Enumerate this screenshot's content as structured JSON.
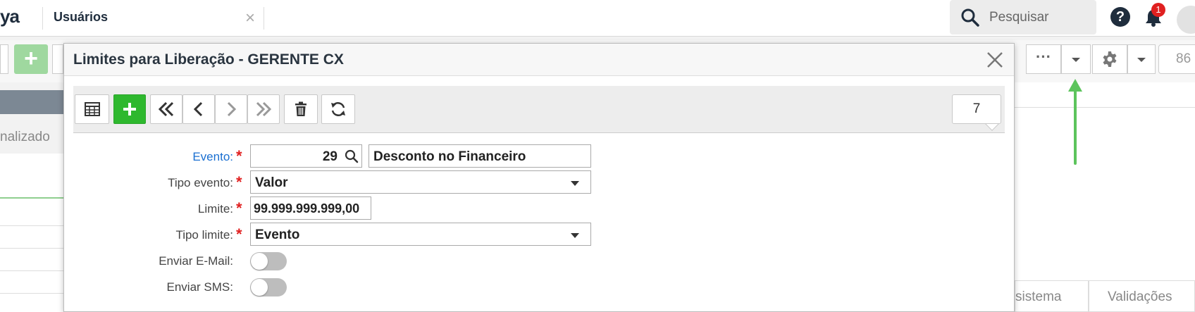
{
  "topbar": {
    "logo_text": "ya",
    "tab_title": "Usuários",
    "tab_close": "×",
    "search_placeholder": "Pesquisar",
    "help_glyph": "?",
    "notification_count": "1"
  },
  "background": {
    "count_value": "86",
    "dots": "···",
    "filter_label": "nalizado",
    "tab_sistema": "sistema",
    "tab_validacoes": "Validações"
  },
  "modal": {
    "title": "Limites para Liberação - GERENTE CX",
    "record_count": "7",
    "fields": {
      "evento": {
        "label": "Evento:",
        "value": "29",
        "description": "Desconto no Financeiro"
      },
      "tipo_evento": {
        "label": "Tipo evento:",
        "value": "Valor"
      },
      "limite": {
        "label": "Limite:",
        "value": "99.999.999.999,00"
      },
      "tipo_limite": {
        "label": "Tipo limite:",
        "value": "Evento"
      },
      "enviar_email": {
        "label": "Enviar E-Mail:",
        "value": false
      },
      "enviar_sms": {
        "label": "Enviar SMS:",
        "value": false
      }
    },
    "required_mark": "*"
  },
  "colors": {
    "add_green": "#2eb82e",
    "link_blue": "#1a6fd1",
    "required_red": "#e02020",
    "annotation_arrow": "#5cc45c"
  }
}
